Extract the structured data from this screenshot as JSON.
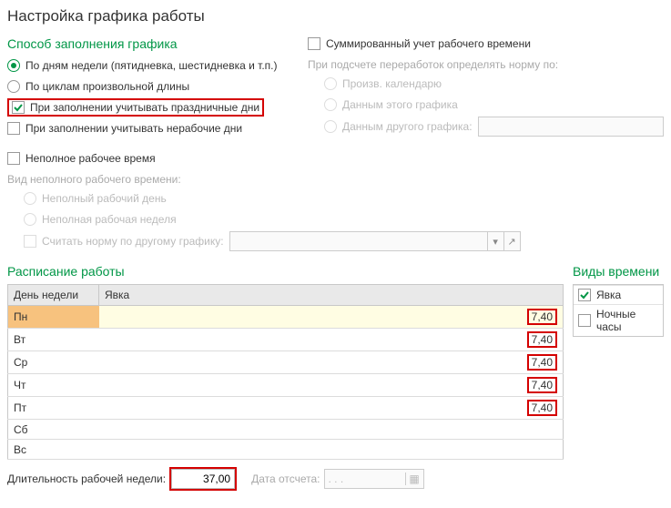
{
  "title": "Настройка графика работы",
  "fill_method": {
    "heading": "Способ заполнения графика",
    "by_days_label": "По дням недели (пятидневка, шестидневка и т.п.)",
    "by_cycles_label": "По циклам произвольной длины",
    "holidays_label": "При заполнении учитывать праздничные дни",
    "nonwork_label": "При заполнении учитывать нерабочие дни"
  },
  "sum_account": {
    "label": "Суммированный учет рабочего времени",
    "sub_label": "При подсчете переработок определять норму по:",
    "opt_calendar": "Произв. календарю",
    "opt_this": "Данным этого графика",
    "opt_other": "Данным другого графика:"
  },
  "part_time": {
    "label": "Неполное рабочее время",
    "type_label": "Вид неполного рабочего времени:",
    "day_label": "Неполный рабочий день",
    "week_label": "Неполная рабочая неделя",
    "other_norm_label": "Считать норму по другому графику:"
  },
  "schedule": {
    "heading": "Расписание работы",
    "col_day": "День недели",
    "col_attend": "Явка",
    "rows": [
      {
        "day": "Пн",
        "value": "7,40"
      },
      {
        "day": "Вт",
        "value": "7,40"
      },
      {
        "day": "Ср",
        "value": "7,40"
      },
      {
        "day": "Чт",
        "value": "7,40"
      },
      {
        "day": "Пт",
        "value": "7,40"
      },
      {
        "day": "Сб",
        "value": ""
      },
      {
        "day": "Вс",
        "value": ""
      }
    ]
  },
  "time_types": {
    "heading": "Виды времени",
    "items": [
      {
        "label": "Явка",
        "checked": true
      },
      {
        "label": "Ночные часы",
        "checked": false
      }
    ]
  },
  "footer": {
    "week_len_label": "Длительность рабочей недели:",
    "week_len_value": "37,00",
    "date_label": "Дата отсчета:",
    "date_placeholder": ".   .   ."
  },
  "icons": {
    "dropdown": "▾",
    "external": "↗",
    "calendar": "▦"
  }
}
